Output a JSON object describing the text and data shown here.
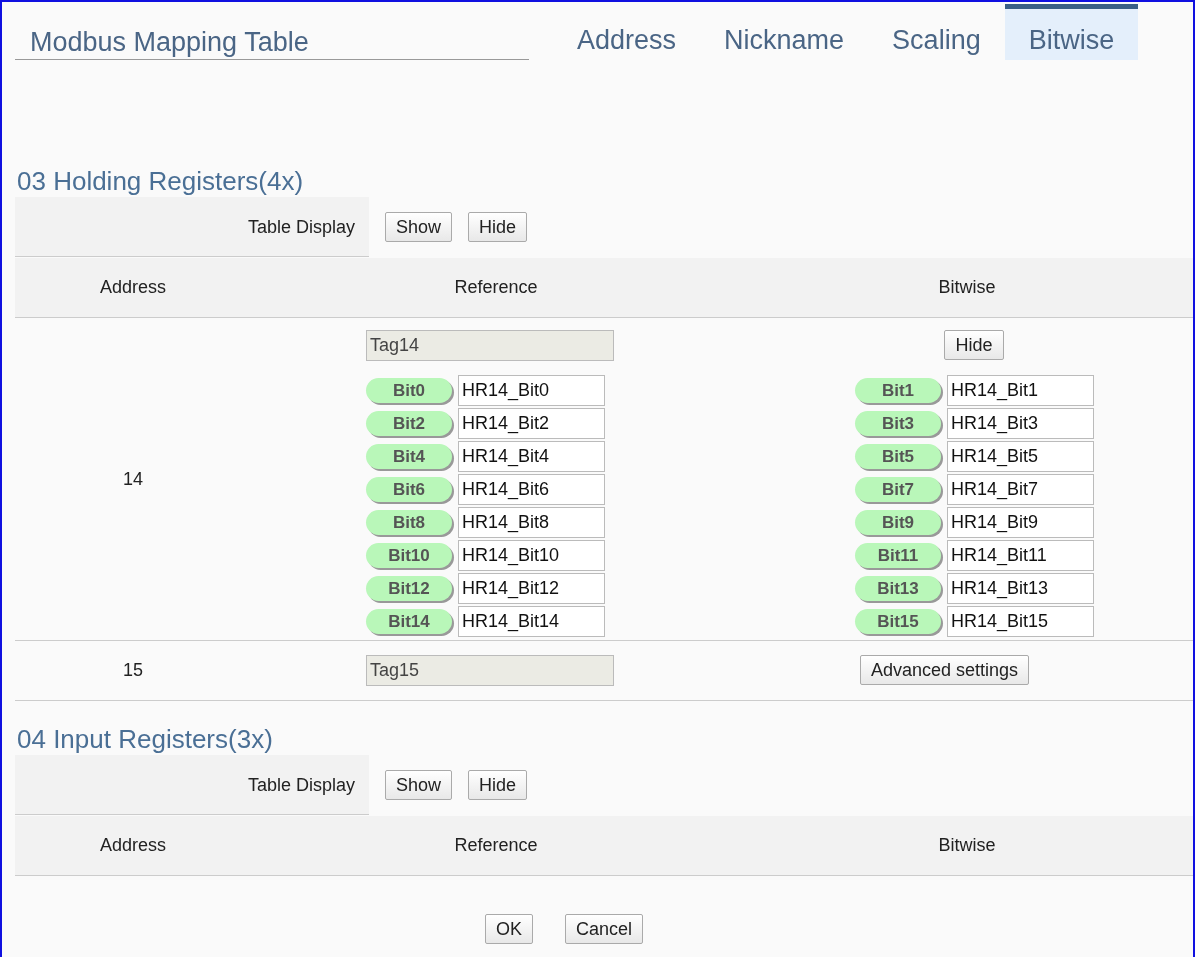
{
  "title": "Modbus Mapping Table",
  "tabs": [
    {
      "label": "Address",
      "selected": false
    },
    {
      "label": "Nickname",
      "selected": false
    },
    {
      "label": "Scaling",
      "selected": false
    },
    {
      "label": "Bitwise",
      "selected": true
    }
  ],
  "sections": [
    {
      "heading": "03 Holding Registers(4x)",
      "table_display_label": "Table Display",
      "display_buttons": [
        "Show",
        "Hide"
      ],
      "columns": [
        "Address",
        "Reference",
        "Bitwise"
      ],
      "rows": [
        {
          "kind": "expanded",
          "address": "14",
          "reference": {
            "value": "Tag14",
            "disabled": true
          },
          "button": "Hide",
          "bits": [
            {
              "label": "Bit0",
              "value": "HR14_Bit0"
            },
            {
              "label": "Bit1",
              "value": "HR14_Bit1"
            },
            {
              "label": "Bit2",
              "value": "HR14_Bit2"
            },
            {
              "label": "Bit3",
              "value": "HR14_Bit3"
            },
            {
              "label": "Bit4",
              "value": "HR14_Bit4"
            },
            {
              "label": "Bit5",
              "value": "HR14_Bit5"
            },
            {
              "label": "Bit6",
              "value": "HR14_Bit6"
            },
            {
              "label": "Bit7",
              "value": "HR14_Bit7"
            },
            {
              "label": "Bit8",
              "value": "HR14_Bit8"
            },
            {
              "label": "Bit9",
              "value": "HR14_Bit9"
            },
            {
              "label": "Bit10",
              "value": "HR14_Bit10"
            },
            {
              "label": "Bit11",
              "value": "HR14_Bit11"
            },
            {
              "label": "Bit12",
              "value": "HR14_Bit12"
            },
            {
              "label": "Bit13",
              "value": "HR14_Bit13"
            },
            {
              "label": "Bit14",
              "value": "HR14_Bit14"
            },
            {
              "label": "Bit15",
              "value": "HR14_Bit15"
            }
          ]
        },
        {
          "kind": "collapsed",
          "address": "15",
          "reference": {
            "value": "Tag15",
            "disabled": true
          },
          "button": "Advanced settings"
        }
      ]
    },
    {
      "heading": "04 Input Registers(3x)",
      "table_display_label": "Table Display",
      "display_buttons": [
        "Show",
        "Hide"
      ],
      "columns": [
        "Address",
        "Reference",
        "Bitwise"
      ]
    }
  ],
  "footer_buttons": [
    "OK",
    "Cancel"
  ]
}
